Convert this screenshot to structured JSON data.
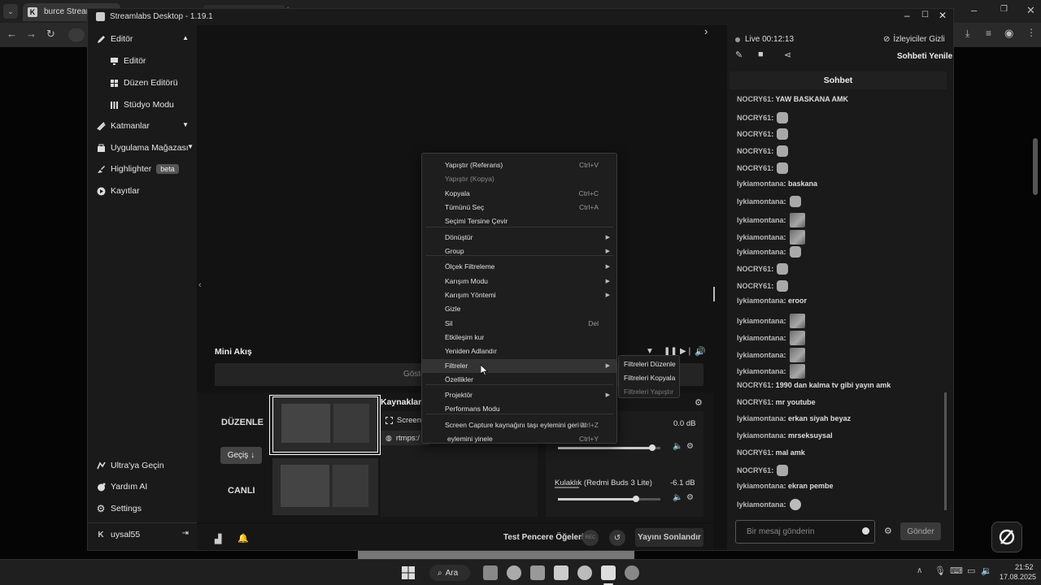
{
  "browser": {
    "tab_title": "burce Stream - W",
    "tab2_title": "",
    "bg_title": ""
  },
  "app": {
    "title": "Streamlabs Desktop - 1.19.1"
  },
  "sidebar": {
    "items": [
      {
        "label": "Editör"
      },
      {
        "label": "Editör"
      },
      {
        "label": "Düzen Editörü"
      },
      {
        "label": "Stüdyo Modu"
      },
      {
        "label": "Katmanlar"
      },
      {
        "label": "Uygulama Mağazası"
      },
      {
        "label": "Highlighter"
      },
      {
        "label": "Kayıtlar"
      }
    ],
    "beta_badge": "beta",
    "bottom": [
      {
        "label": "Ultra'ya Geçin"
      },
      {
        "label": "Yardım AI"
      },
      {
        "label": "Settings"
      }
    ],
    "user": "uysal55"
  },
  "main": {
    "mini_akis": "Mini Akış",
    "goster": "Göste",
    "duzenle": "DÜZENLE",
    "gecis": "Geçiş",
    "canli": "CANLI",
    "kaynaklar": "Kaynaklar",
    "source1": "Screen",
    "source2": "rtmps:/",
    "mixer_db1": "0.0 dB",
    "mixer_name2": "Kulaklık (Redmi Buds 3 Lite)",
    "mixer_db2": "-6.1 dB",
    "mixer_level1": 0.92,
    "mixer_level2": 0.76,
    "footer_test": "Test Pencere Öğeleri",
    "rec": "REC",
    "end_stream": "Yayını Sonlandır"
  },
  "context_menu": {
    "items": [
      {
        "label": "Yapıştır (Referans)",
        "shortcut": "Ctrl+V"
      },
      {
        "label": "Yapıştır (Kopya)",
        "disabled": true
      },
      {
        "label": "Kopyala",
        "shortcut": "Ctrl+C"
      },
      {
        "label": "Tümünü Seç",
        "shortcut": "Ctrl+A"
      },
      {
        "label": "Seçimi Tersine Çevir"
      },
      {
        "label": "Dönüştür",
        "submenu": true
      },
      {
        "label": "Group",
        "submenu": true
      },
      {
        "label": "Ölçek Filtreleme",
        "submenu": true
      },
      {
        "label": "Karışım Modu",
        "submenu": true
      },
      {
        "label": "Karışım Yöntemi",
        "submenu": true
      },
      {
        "label": "Gizle"
      },
      {
        "label": "Sil",
        "shortcut": "Del"
      },
      {
        "label": "Etkileşim kur"
      },
      {
        "label": "Yeniden Adlandır"
      },
      {
        "label": "Filtreler",
        "submenu": true
      },
      {
        "label": "Özellikler"
      },
      {
        "label": "Projektör",
        "submenu": true
      },
      {
        "label": "Performans Modu"
      },
      {
        "label": "Screen Capture kaynağını taşı eylemini geri al",
        "shortcut": "Ctrl+Z"
      },
      {
        "label": "eylemini yinele",
        "shortcut": "Ctrl+Y"
      }
    ],
    "submenu": [
      {
        "label": "Filtreleri Düzenle"
      },
      {
        "label": "Filtreleri Kopyala"
      },
      {
        "label": "Filtreleri Yapıştır",
        "disabled": true
      }
    ]
  },
  "chat": {
    "live": "Live 00:12:13",
    "viewers_hidden": "İzleyiciler Gizli",
    "refresh": "Sohbeti Yenile",
    "header": "Sohbet",
    "messages": [
      {
        "user": "NOCRY61",
        "text": ": YAW BASKANA AMK"
      },
      {
        "user": "NOCRY61",
        "text": ":",
        "emote": "smile"
      },
      {
        "user": "NOCRY61",
        "text": ":",
        "emote": "smile"
      },
      {
        "user": "NOCRY61",
        "text": ":",
        "emote": "smile"
      },
      {
        "user": "NOCRY61",
        "text": ":",
        "emote": "smile"
      },
      {
        "user": "lykiamontana",
        "text": ": baskana"
      },
      {
        "user": "lykiamontana",
        "text": ":",
        "emote": "smile"
      },
      {
        "user": "lykiamontana",
        "text": ":",
        "emote": "img"
      },
      {
        "user": "lykiamontana",
        "text": ":",
        "emote": "img"
      },
      {
        "user": "lykiamontana",
        "text": ":",
        "emote": "smile"
      },
      {
        "user": "NOCRY61",
        "text": ":",
        "emote": "smile"
      },
      {
        "user": "NOCRY61",
        "text": ":",
        "emote": "smile"
      },
      {
        "user": "lykiamontana",
        "text": ": eroor"
      },
      {
        "user": "lykiamontana",
        "text": ":",
        "emote": "img"
      },
      {
        "user": "lykiamontana",
        "text": ":",
        "emote": "img"
      },
      {
        "user": "lykiamontana",
        "text": ":",
        "emote": "img"
      },
      {
        "user": "lykiamontana",
        "text": ":",
        "emote": "img"
      },
      {
        "user": "NOCRY61",
        "text": ": 1990 dan kalma tv gibi yayın amk"
      },
      {
        "user": "NOCRY61",
        "text": ": mr youtube"
      },
      {
        "user": "lykiamontana",
        "text": ": erkan siyah beyaz"
      },
      {
        "user": "lykiamontana",
        "text": ": mrseksuysal"
      },
      {
        "user": "NOCRY61",
        "text": ": mal amk"
      },
      {
        "user": "NOCRY61",
        "text": ":",
        "emote": "smile"
      },
      {
        "user": "lykiamontana",
        "text": ": ekran pembe"
      },
      {
        "user": "lykiamontana",
        "text": ":",
        "emote": "blob"
      }
    ],
    "input_placeholder": "Bir mesaj gönderin",
    "send": "Gönder"
  },
  "taskbar": {
    "search": "Ara",
    "time": "21:52",
    "date": "17.08.2025"
  }
}
